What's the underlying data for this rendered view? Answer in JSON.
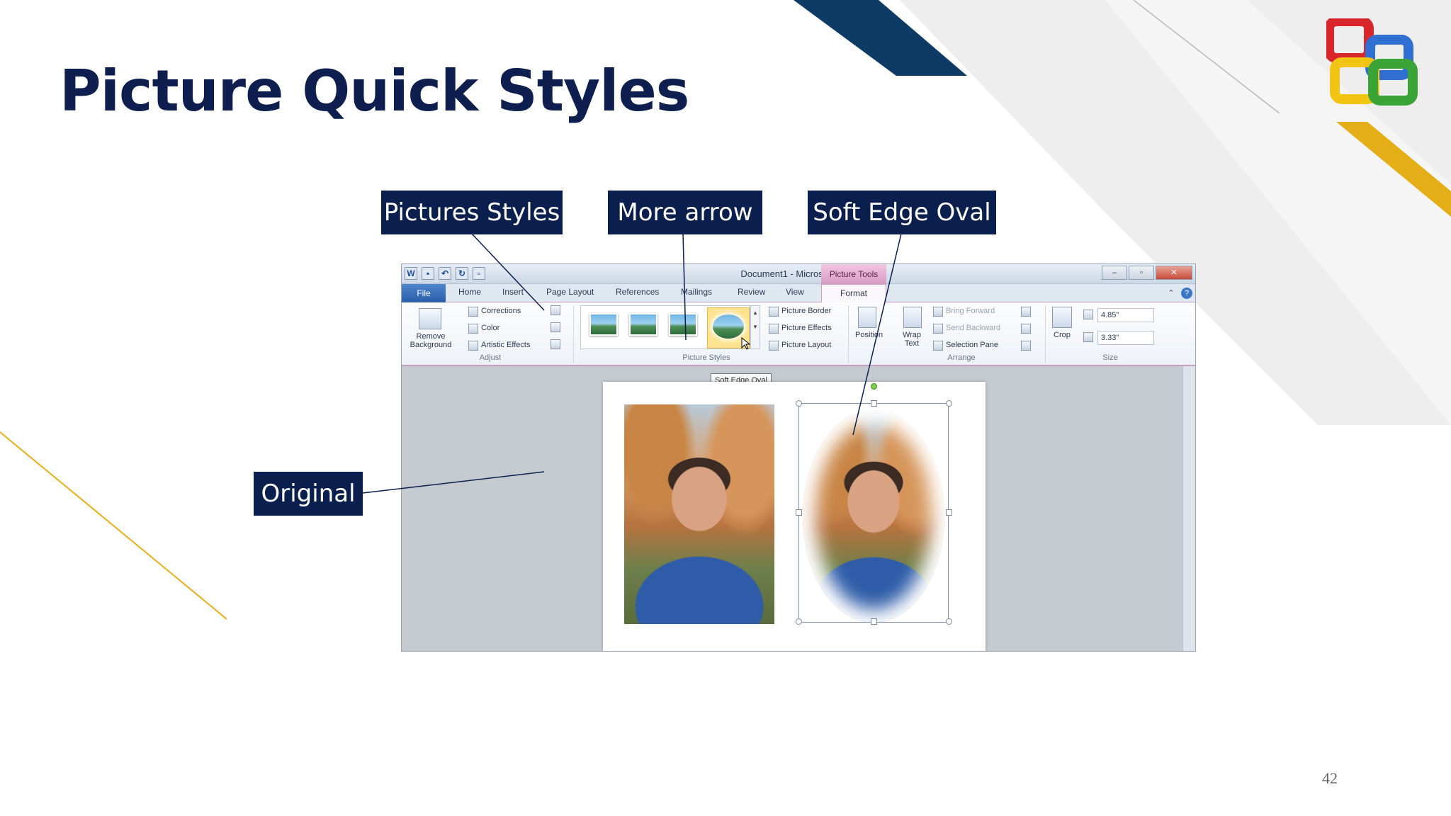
{
  "slide": {
    "title": "Picture Quick Styles",
    "page_number": "42"
  },
  "callouts": {
    "pictures_styles": "Pictures Styles",
    "more_arrow": "More arrow",
    "soft_edge_oval": "Soft Edge Oval",
    "original": "Original"
  },
  "word": {
    "window_title": "Document1 - Microsoft Word",
    "context_tab": "Picture Tools",
    "tabs": [
      "File",
      "Home",
      "Insert",
      "Page Layout",
      "References",
      "Mailings",
      "Review",
      "View",
      "Format"
    ],
    "adjust": {
      "remove_background": "Remove Background",
      "corrections": "Corrections",
      "color": "Color",
      "artistic_effects": "Artistic Effects",
      "group_label": "Adjust"
    },
    "picture_styles": {
      "picture_border": "Picture Border",
      "picture_effects": "Picture Effects",
      "picture_layout": "Picture Layout",
      "group_label": "Picture Styles"
    },
    "arrange": {
      "position": "Position",
      "wrap_text": "Wrap Text",
      "bring_forward": "Bring Forward",
      "send_backward": "Send Backward",
      "selection_pane": "Selection Pane",
      "group_label": "Arrange"
    },
    "size": {
      "crop": "Crop",
      "height": "4.85\"",
      "width": "3.33\"",
      "group_label": "Size"
    },
    "tooltip": "Soft Edge Oval"
  },
  "colors": {
    "title": "#0e1f4f",
    "callout_bg": "#0b1f4e",
    "navy_band": "#0d3b66",
    "gold": "#e3ae18"
  }
}
